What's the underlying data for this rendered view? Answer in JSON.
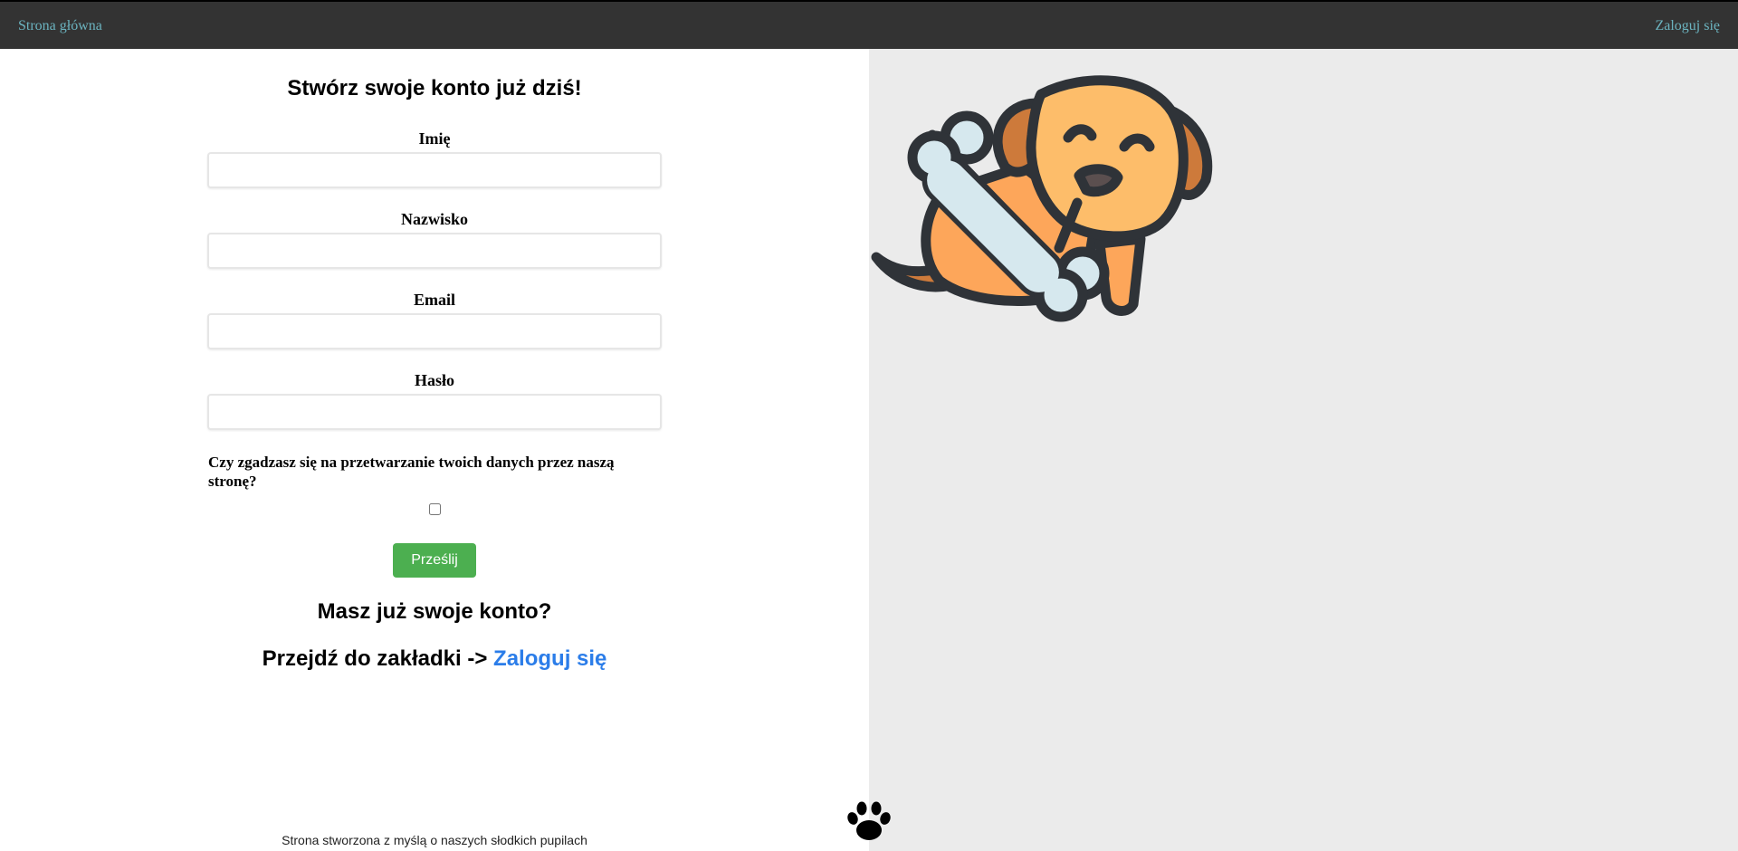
{
  "nav": {
    "home_label": "Strona główna",
    "login_label": "Zaloguj się"
  },
  "form": {
    "title": "Stwórz swoje konto już dziś!",
    "fields": [
      {
        "label": "Imię",
        "value": ""
      },
      {
        "label": "Nazwisko",
        "value": ""
      },
      {
        "label": "Email",
        "value": ""
      },
      {
        "label": "Hasło",
        "value": ""
      }
    ],
    "consent_text": "Czy zgadzasz się na przetwarzanie twoich danych przez naszą stronę?",
    "consent_checked": false,
    "submit_label": "Prześlij"
  },
  "login_prompt": {
    "question": "Masz już swoje konto?",
    "goto_text": "Przejdź do zakładki -> ",
    "goto_link": "Zaloguj się"
  },
  "footer": {
    "text": "Strona stworzona z myślą o naszych słodkich pupilach",
    "icon": "paw-icon"
  },
  "illustration": {
    "icon": "dog-with-bone-illustration"
  },
  "colors": {
    "navbar_bg": "#333333",
    "nav_link": "#6bb3bf",
    "submit_bg": "#4caf50",
    "link_blue": "#2b7de9",
    "right_pane_bg": "#ebebeb"
  }
}
